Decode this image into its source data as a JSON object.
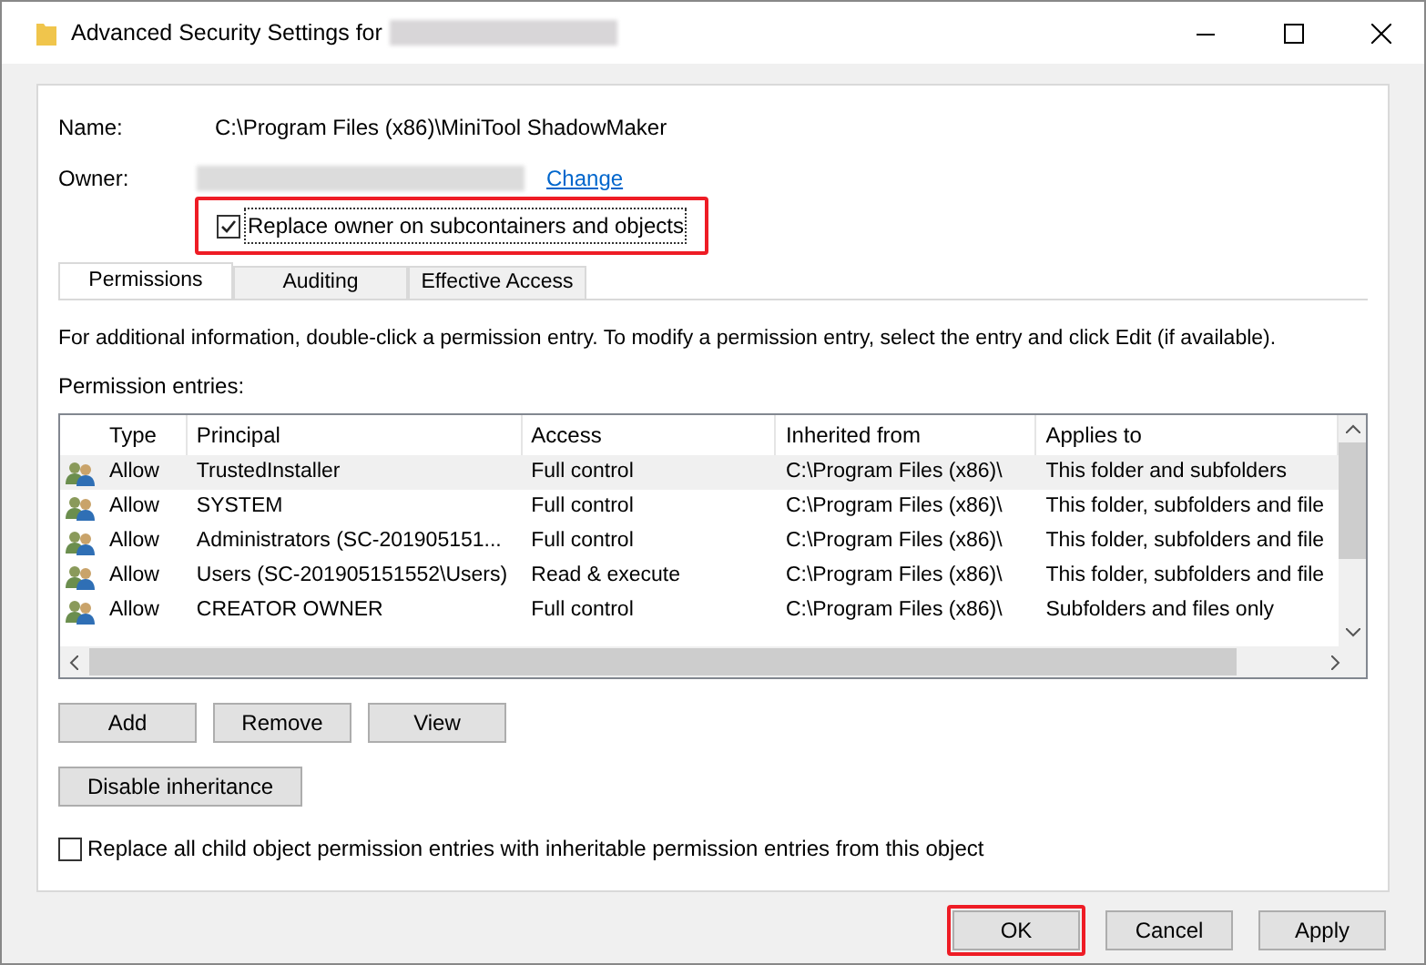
{
  "window": {
    "title": "Advanced Security Settings for"
  },
  "name_label": "Name:",
  "name_value": "C:\\Program Files (x86)\\MiniTool ShadowMaker",
  "owner_label": "Owner:",
  "owner_link": "Change",
  "replace_owner": {
    "label": "Replace owner on subcontainers and objects",
    "checked": true,
    "highlighted": true
  },
  "tabs": [
    {
      "label": "Permissions",
      "selected": true
    },
    {
      "label": "Auditing",
      "selected": false
    },
    {
      "label": "Effective Access",
      "selected": false
    }
  ],
  "info": "For additional information, double-click a permission entry. To modify a permission entry, select the entry and click Edit (if available).",
  "entries_label": "Permission entries:",
  "table": {
    "columns": [
      "Type",
      "Principal",
      "Access",
      "Inherited from",
      "Applies to"
    ],
    "rows": [
      {
        "selected": true,
        "cells": [
          "Allow",
          "TrustedInstaller",
          "Full control",
          "C:\\Program Files (x86)\\",
          "This folder and subfolders"
        ]
      },
      {
        "selected": false,
        "cells": [
          "Allow",
          "SYSTEM",
          "Full control",
          "C:\\Program Files (x86)\\",
          "This folder, subfolders and file"
        ]
      },
      {
        "selected": false,
        "cells": [
          "Allow",
          "Administrators (SC-201905151...",
          "Full control",
          "C:\\Program Files (x86)\\",
          "This folder, subfolders and file"
        ]
      },
      {
        "selected": false,
        "cells": [
          "Allow",
          "Users (SC-201905151552\\Users)",
          "Read & execute",
          "C:\\Program Files (x86)\\",
          "This folder, subfolders and file"
        ]
      },
      {
        "selected": false,
        "cells": [
          "Allow",
          "CREATOR OWNER",
          "Full control",
          "C:\\Program Files (x86)\\",
          "Subfolders and files only"
        ]
      }
    ]
  },
  "entry_buttons": [
    "Add",
    "Remove",
    "View"
  ],
  "inheritance_button": "Disable inheritance",
  "replace_child": {
    "label": "Replace all child object permission entries with inheritable permission entries from this object",
    "checked": false
  },
  "footer_buttons": [
    {
      "label": "OK",
      "highlighted": true
    },
    {
      "label": "Cancel",
      "highlighted": false
    },
    {
      "label": "Apply",
      "highlighted": false
    }
  ]
}
